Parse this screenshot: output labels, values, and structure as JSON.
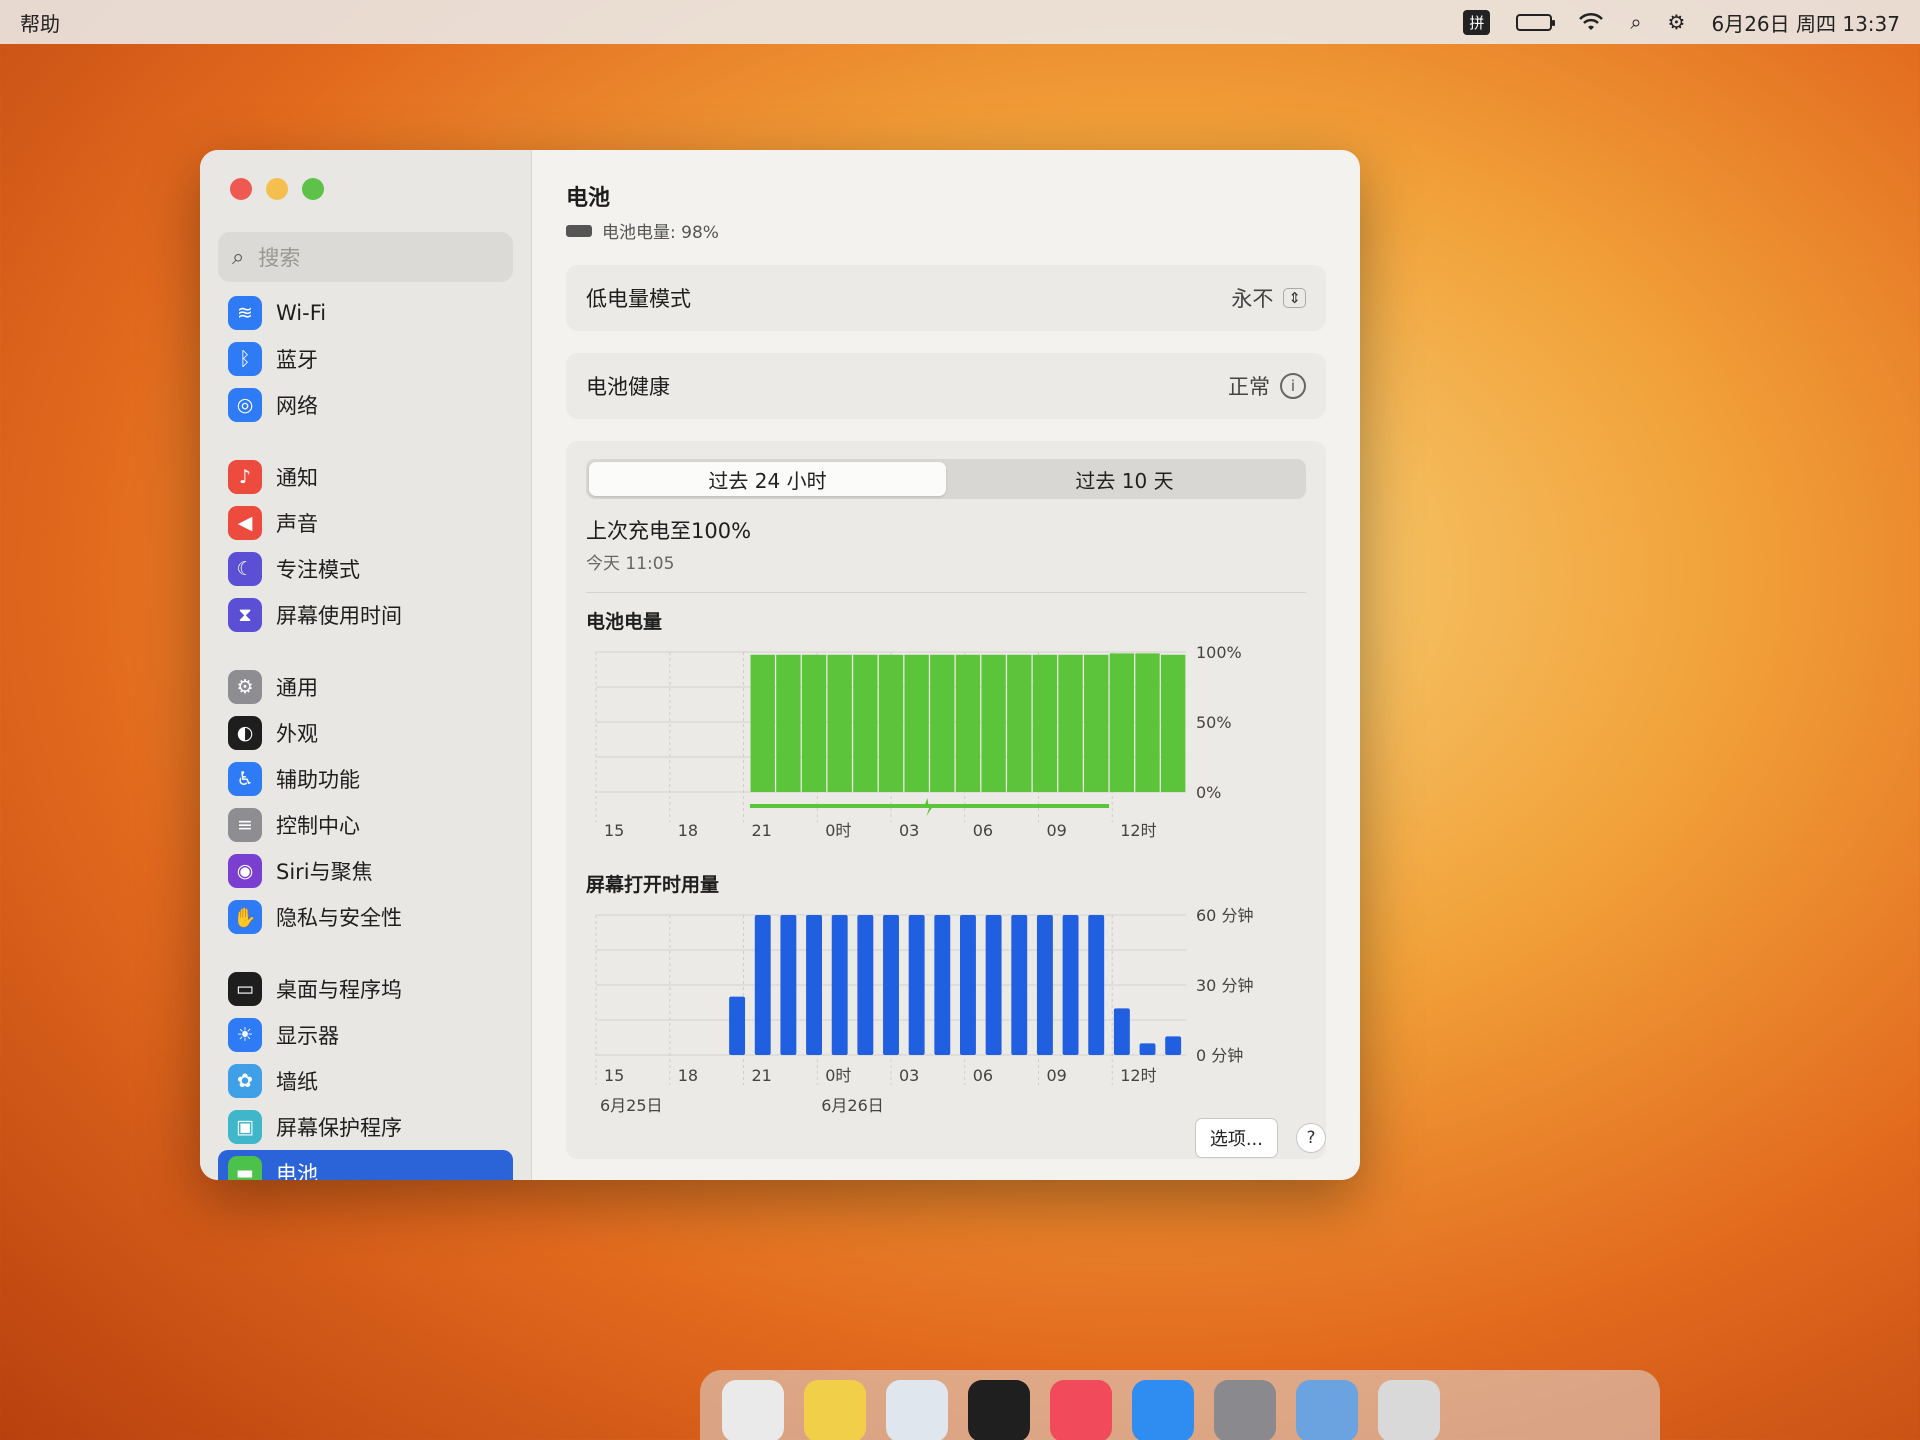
{
  "menubar": {
    "app_menu": "帮助",
    "ime": "拼",
    "datetime": "6月26日 周四 13:37"
  },
  "sidebar": {
    "search_placeholder": "搜索",
    "groups": [
      [
        {
          "label": "Wi-Fi",
          "icon": "wifi-icon",
          "color": "#2f7bf5"
        },
        {
          "label": "蓝牙",
          "icon": "bluetooth-icon",
          "color": "#2f7bf5"
        },
        {
          "label": "网络",
          "icon": "globe-icon",
          "color": "#2f7bf5"
        }
      ],
      [
        {
          "label": "通知",
          "icon": "bell-icon",
          "color": "#ee4b3f"
        },
        {
          "label": "声音",
          "icon": "speaker-icon",
          "color": "#ee4b3f"
        },
        {
          "label": "专注模式",
          "icon": "moon-icon",
          "color": "#5b4fd6"
        },
        {
          "label": "屏幕使用时间",
          "icon": "hourglass-icon",
          "color": "#5b4fd6"
        }
      ],
      [
        {
          "label": "通用",
          "icon": "gear-icon",
          "color": "#8d8d92"
        },
        {
          "label": "外观",
          "icon": "appearance-icon",
          "color": "#1e1e1e"
        },
        {
          "label": "辅助功能",
          "icon": "accessibility-icon",
          "color": "#2f7bf5"
        },
        {
          "label": "控制中心",
          "icon": "switches-icon",
          "color": "#8d8d92"
        },
        {
          "label": "Siri与聚焦",
          "icon": "siri-icon",
          "color": "#7a3fd0"
        },
        {
          "label": "隐私与安全性",
          "icon": "hand-icon",
          "color": "#2f7bf5"
        }
      ],
      [
        {
          "label": "桌面与程序坞",
          "icon": "dock-icon",
          "color": "#1e1e1e"
        },
        {
          "label": "显示器",
          "icon": "sun-icon",
          "color": "#2f7bf5"
        },
        {
          "label": "墙纸",
          "icon": "flower-icon",
          "color": "#3fa0e8"
        },
        {
          "label": "屏幕保护程序",
          "icon": "screensaver-icon",
          "color": "#3fb6c9"
        },
        {
          "label": "电池",
          "icon": "battery-icon",
          "color": "#4cc24a",
          "active": true
        }
      ]
    ]
  },
  "main": {
    "title": "电池",
    "subtitle": "电池电量: 98%",
    "low_power": {
      "label": "低电量模式",
      "value": "永不"
    },
    "health": {
      "label": "电池健康",
      "value": "正常"
    },
    "tabs": [
      "过去 24 小时",
      "过去 10 天"
    ],
    "active_tab": 0,
    "last_charge": "上次充电至100%",
    "last_charge_time": "今天 11:05",
    "options_button": "选项...",
    "help_button": "?"
  },
  "chart_data": [
    {
      "type": "bar",
      "title": "电池电量",
      "x_ticks": [
        "15",
        "18",
        "21",
        "0时",
        "03",
        "06",
        "09",
        "12时"
      ],
      "y_ticks": [
        "100%",
        "50%",
        "0%"
      ],
      "ylim": [
        0,
        100
      ],
      "charging_indicator": true,
      "categories": [
        "15",
        "16",
        "17",
        "18",
        "19",
        "20",
        "21",
        "22",
        "23",
        "0",
        "1",
        "2",
        "3",
        "4",
        "5",
        "6",
        "7",
        "8",
        "9",
        "10",
        "11",
        "12",
        "13"
      ],
      "values": [
        0,
        0,
        0,
        0,
        0,
        0,
        98,
        98,
        98,
        98,
        98,
        98,
        98,
        98,
        98,
        98,
        98,
        98,
        98,
        98,
        99,
        99,
        98
      ],
      "color": "#5cc43a"
    },
    {
      "type": "bar",
      "title": "屏幕打开时用量",
      "x_ticks": [
        "15",
        "18",
        "21",
        "0时",
        "03",
        "06",
        "09",
        "12时"
      ],
      "date_labels": [
        "6月25日",
        "6月26日"
      ],
      "y_ticks": [
        "60 分钟",
        "30 分钟",
        "0 分钟"
      ],
      "ylim": [
        0,
        60
      ],
      "categories": [
        "15",
        "16",
        "17",
        "18",
        "19",
        "20",
        "21",
        "22",
        "23",
        "0",
        "1",
        "2",
        "3",
        "4",
        "5",
        "6",
        "7",
        "8",
        "9",
        "10",
        "11",
        "12",
        "13"
      ],
      "values": [
        0,
        0,
        0,
        0,
        0,
        25,
        60,
        60,
        60,
        60,
        60,
        60,
        60,
        60,
        60,
        60,
        60,
        60,
        60,
        60,
        20,
        5,
        8
      ],
      "color": "#1f5fe0"
    }
  ]
}
